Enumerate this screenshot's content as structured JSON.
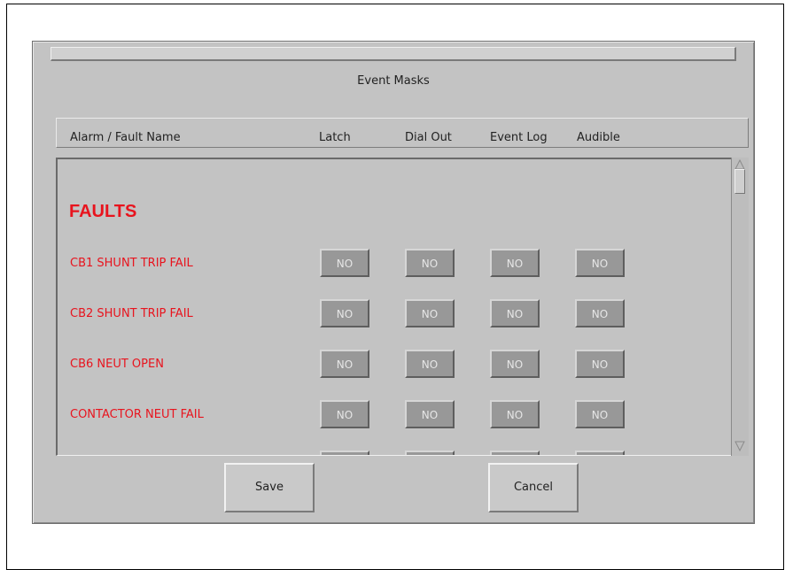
{
  "dialog": {
    "title": "Event Masks",
    "columns": [
      "Alarm / Fault Name",
      "Latch",
      "Dial Out",
      "Event Log",
      "Audible"
    ]
  },
  "list": {
    "section_title": "FAULTS",
    "rows": [
      {
        "name": "CB1 SHUNT TRIP FAIL",
        "latch": "NO",
        "dial_out": "NO",
        "event_log": "NO",
        "audible": "NO"
      },
      {
        "name": "CB2 SHUNT TRIP FAIL",
        "latch": "NO",
        "dial_out": "NO",
        "event_log": "NO",
        "audible": "NO"
      },
      {
        "name": "CB6 NEUT OPEN",
        "latch": "NO",
        "dial_out": "NO",
        "event_log": "NO",
        "audible": "NO"
      },
      {
        "name": "CONTACTOR NEUT FAIL",
        "latch": "NO",
        "dial_out": "NO",
        "event_log": "NO",
        "audible": "NO"
      }
    ]
  },
  "buttons": {
    "save": "Save",
    "cancel": "Cancel"
  },
  "colors": {
    "fault_text": "#e8141e",
    "panel_bg": "#c3c3c3",
    "toggle_bg": "#989898"
  },
  "icons": {
    "scroll_up": "triangle-up-icon",
    "scroll_down": "triangle-down-icon"
  }
}
